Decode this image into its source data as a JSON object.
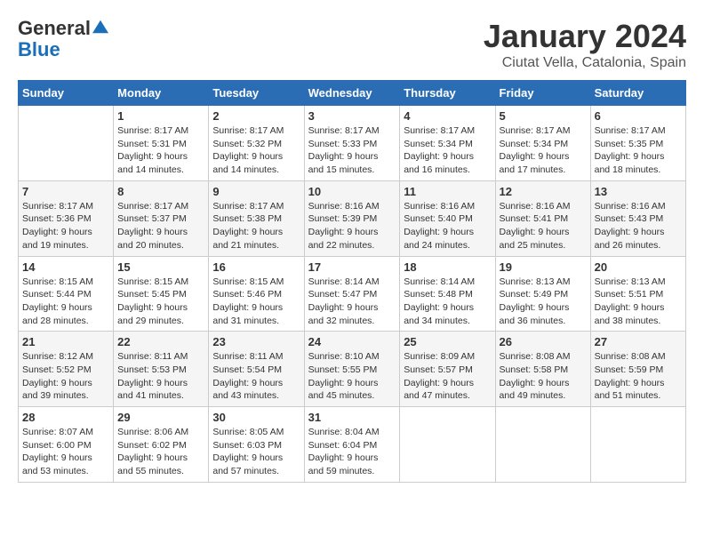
{
  "logo": {
    "line1": "General",
    "line2": "Blue"
  },
  "title": "January 2024",
  "location": "Ciutat Vella, Catalonia, Spain",
  "weekdays": [
    "Sunday",
    "Monday",
    "Tuesday",
    "Wednesday",
    "Thursday",
    "Friday",
    "Saturday"
  ],
  "weeks": [
    [
      {
        "day": "",
        "sunrise": "",
        "sunset": "",
        "daylight": ""
      },
      {
        "day": "1",
        "sunrise": "Sunrise: 8:17 AM",
        "sunset": "Sunset: 5:31 PM",
        "daylight": "Daylight: 9 hours and 14 minutes."
      },
      {
        "day": "2",
        "sunrise": "Sunrise: 8:17 AM",
        "sunset": "Sunset: 5:32 PM",
        "daylight": "Daylight: 9 hours and 14 minutes."
      },
      {
        "day": "3",
        "sunrise": "Sunrise: 8:17 AM",
        "sunset": "Sunset: 5:33 PM",
        "daylight": "Daylight: 9 hours and 15 minutes."
      },
      {
        "day": "4",
        "sunrise": "Sunrise: 8:17 AM",
        "sunset": "Sunset: 5:34 PM",
        "daylight": "Daylight: 9 hours and 16 minutes."
      },
      {
        "day": "5",
        "sunrise": "Sunrise: 8:17 AM",
        "sunset": "Sunset: 5:34 PM",
        "daylight": "Daylight: 9 hours and 17 minutes."
      },
      {
        "day": "6",
        "sunrise": "Sunrise: 8:17 AM",
        "sunset": "Sunset: 5:35 PM",
        "daylight": "Daylight: 9 hours and 18 minutes."
      }
    ],
    [
      {
        "day": "7",
        "sunrise": "Sunrise: 8:17 AM",
        "sunset": "Sunset: 5:36 PM",
        "daylight": "Daylight: 9 hours and 19 minutes."
      },
      {
        "day": "8",
        "sunrise": "Sunrise: 8:17 AM",
        "sunset": "Sunset: 5:37 PM",
        "daylight": "Daylight: 9 hours and 20 minutes."
      },
      {
        "day": "9",
        "sunrise": "Sunrise: 8:17 AM",
        "sunset": "Sunset: 5:38 PM",
        "daylight": "Daylight: 9 hours and 21 minutes."
      },
      {
        "day": "10",
        "sunrise": "Sunrise: 8:16 AM",
        "sunset": "Sunset: 5:39 PM",
        "daylight": "Daylight: 9 hours and 22 minutes."
      },
      {
        "day": "11",
        "sunrise": "Sunrise: 8:16 AM",
        "sunset": "Sunset: 5:40 PM",
        "daylight": "Daylight: 9 hours and 24 minutes."
      },
      {
        "day": "12",
        "sunrise": "Sunrise: 8:16 AM",
        "sunset": "Sunset: 5:41 PM",
        "daylight": "Daylight: 9 hours and 25 minutes."
      },
      {
        "day": "13",
        "sunrise": "Sunrise: 8:16 AM",
        "sunset": "Sunset: 5:43 PM",
        "daylight": "Daylight: 9 hours and 26 minutes."
      }
    ],
    [
      {
        "day": "14",
        "sunrise": "Sunrise: 8:15 AM",
        "sunset": "Sunset: 5:44 PM",
        "daylight": "Daylight: 9 hours and 28 minutes."
      },
      {
        "day": "15",
        "sunrise": "Sunrise: 8:15 AM",
        "sunset": "Sunset: 5:45 PM",
        "daylight": "Daylight: 9 hours and 29 minutes."
      },
      {
        "day": "16",
        "sunrise": "Sunrise: 8:15 AM",
        "sunset": "Sunset: 5:46 PM",
        "daylight": "Daylight: 9 hours and 31 minutes."
      },
      {
        "day": "17",
        "sunrise": "Sunrise: 8:14 AM",
        "sunset": "Sunset: 5:47 PM",
        "daylight": "Daylight: 9 hours and 32 minutes."
      },
      {
        "day": "18",
        "sunrise": "Sunrise: 8:14 AM",
        "sunset": "Sunset: 5:48 PM",
        "daylight": "Daylight: 9 hours and 34 minutes."
      },
      {
        "day": "19",
        "sunrise": "Sunrise: 8:13 AM",
        "sunset": "Sunset: 5:49 PM",
        "daylight": "Daylight: 9 hours and 36 minutes."
      },
      {
        "day": "20",
        "sunrise": "Sunrise: 8:13 AM",
        "sunset": "Sunset: 5:51 PM",
        "daylight": "Daylight: 9 hours and 38 minutes."
      }
    ],
    [
      {
        "day": "21",
        "sunrise": "Sunrise: 8:12 AM",
        "sunset": "Sunset: 5:52 PM",
        "daylight": "Daylight: 9 hours and 39 minutes."
      },
      {
        "day": "22",
        "sunrise": "Sunrise: 8:11 AM",
        "sunset": "Sunset: 5:53 PM",
        "daylight": "Daylight: 9 hours and 41 minutes."
      },
      {
        "day": "23",
        "sunrise": "Sunrise: 8:11 AM",
        "sunset": "Sunset: 5:54 PM",
        "daylight": "Daylight: 9 hours and 43 minutes."
      },
      {
        "day": "24",
        "sunrise": "Sunrise: 8:10 AM",
        "sunset": "Sunset: 5:55 PM",
        "daylight": "Daylight: 9 hours and 45 minutes."
      },
      {
        "day": "25",
        "sunrise": "Sunrise: 8:09 AM",
        "sunset": "Sunset: 5:57 PM",
        "daylight": "Daylight: 9 hours and 47 minutes."
      },
      {
        "day": "26",
        "sunrise": "Sunrise: 8:08 AM",
        "sunset": "Sunset: 5:58 PM",
        "daylight": "Daylight: 9 hours and 49 minutes."
      },
      {
        "day": "27",
        "sunrise": "Sunrise: 8:08 AM",
        "sunset": "Sunset: 5:59 PM",
        "daylight": "Daylight: 9 hours and 51 minutes."
      }
    ],
    [
      {
        "day": "28",
        "sunrise": "Sunrise: 8:07 AM",
        "sunset": "Sunset: 6:00 PM",
        "daylight": "Daylight: 9 hours and 53 minutes."
      },
      {
        "day": "29",
        "sunrise": "Sunrise: 8:06 AM",
        "sunset": "Sunset: 6:02 PM",
        "daylight": "Daylight: 9 hours and 55 minutes."
      },
      {
        "day": "30",
        "sunrise": "Sunrise: 8:05 AM",
        "sunset": "Sunset: 6:03 PM",
        "daylight": "Daylight: 9 hours and 57 minutes."
      },
      {
        "day": "31",
        "sunrise": "Sunrise: 8:04 AM",
        "sunset": "Sunset: 6:04 PM",
        "daylight": "Daylight: 9 hours and 59 minutes."
      },
      {
        "day": "",
        "sunrise": "",
        "sunset": "",
        "daylight": ""
      },
      {
        "day": "",
        "sunrise": "",
        "sunset": "",
        "daylight": ""
      },
      {
        "day": "",
        "sunrise": "",
        "sunset": "",
        "daylight": ""
      }
    ]
  ]
}
